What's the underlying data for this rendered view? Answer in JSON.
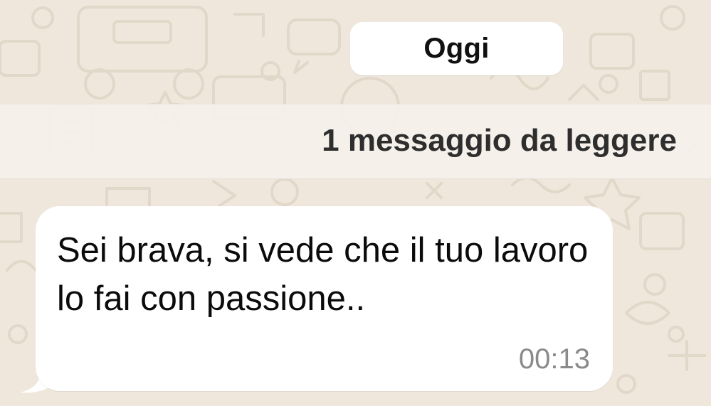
{
  "chat": {
    "date_separator": "Oggi",
    "unread_banner": "1 messaggio da leggere",
    "message": {
      "text": "Sei brava, si vede che il tuo lavoro lo fai con passione..",
      "time": "00:13"
    }
  },
  "colors": {
    "wallpaper": "#efe7dc",
    "doodle": "#e2d8c9",
    "bubble": "#ffffff",
    "time_text": "#8a8a8a"
  }
}
